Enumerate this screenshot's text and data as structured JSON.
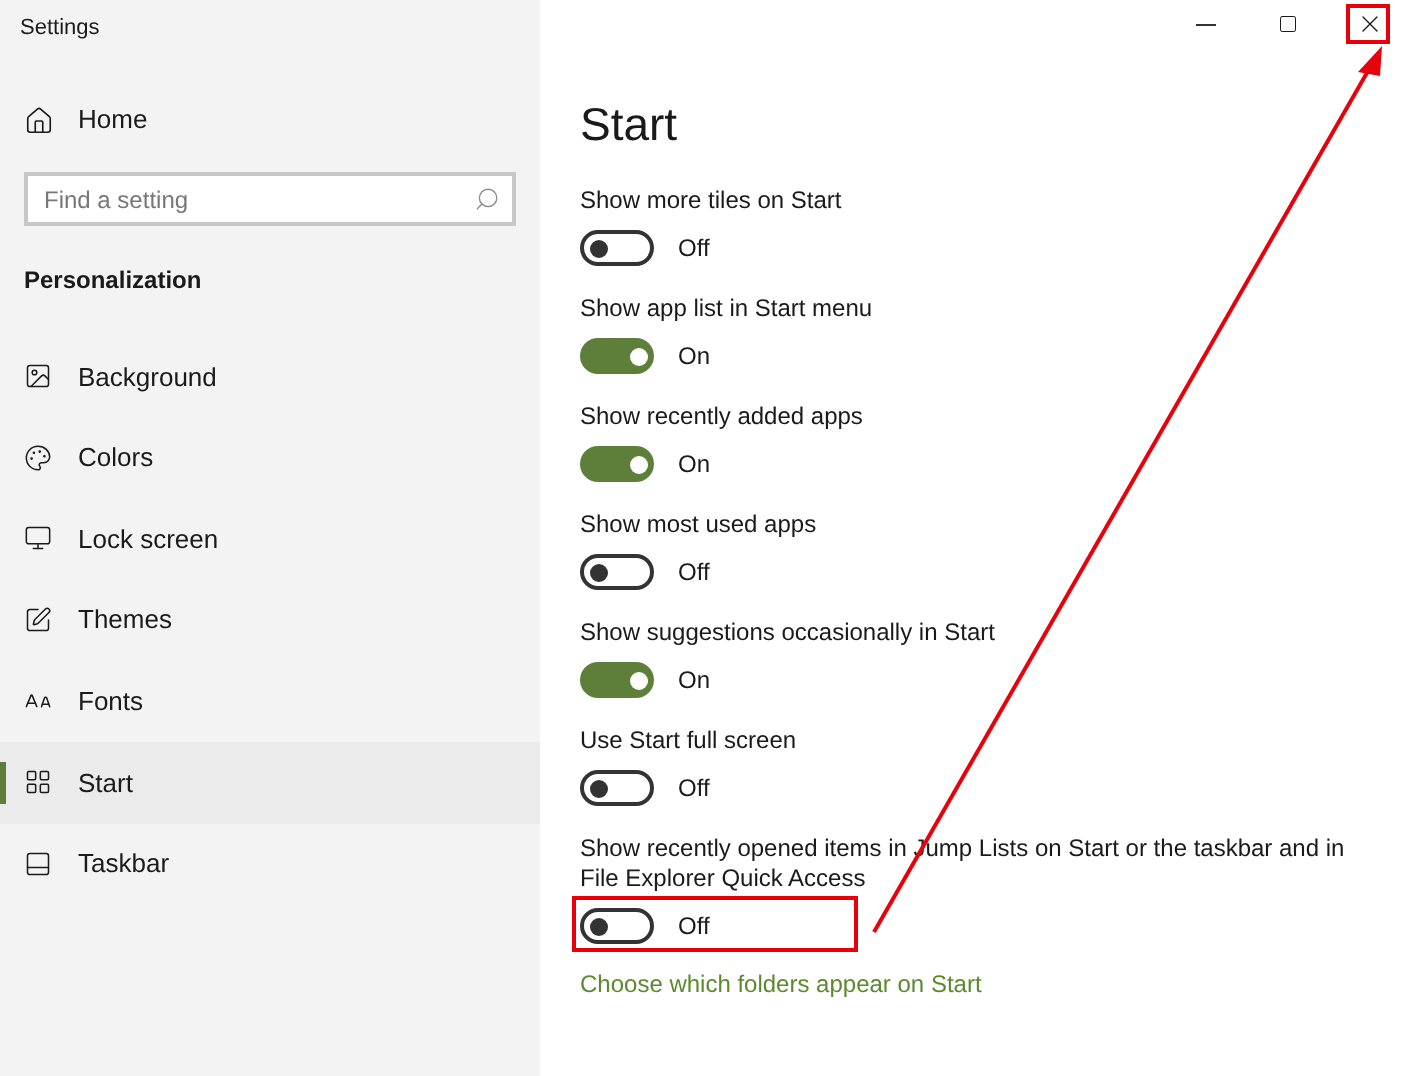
{
  "window": {
    "title": "Settings"
  },
  "sidebar": {
    "home": "Home",
    "search": {
      "placeholder": "Find a setting"
    },
    "section": "Personalization",
    "items": [
      {
        "label": "Background",
        "selected": false
      },
      {
        "label": "Colors",
        "selected": false
      },
      {
        "label": "Lock screen",
        "selected": false
      },
      {
        "label": "Themes",
        "selected": false
      },
      {
        "label": "Fonts",
        "selected": false
      },
      {
        "label": "Start",
        "selected": true
      },
      {
        "label": "Taskbar",
        "selected": false
      }
    ]
  },
  "page": {
    "title": "Start",
    "settings": [
      {
        "label": "Show more tiles on Start",
        "on": false,
        "status": "Off"
      },
      {
        "label": "Show app list in Start menu",
        "on": true,
        "status": "On"
      },
      {
        "label": "Show recently added apps",
        "on": true,
        "status": "On"
      },
      {
        "label": "Show most used apps",
        "on": false,
        "status": "Off"
      },
      {
        "label": "Show suggestions occasionally in Start",
        "on": true,
        "status": "On"
      },
      {
        "label": "Use Start full screen",
        "on": false,
        "status": "Off"
      },
      {
        "label": "Show recently opened items in Jump Lists on Start or the taskbar and in File Explorer Quick Access",
        "on": false,
        "status": "Off",
        "highlighted": true
      }
    ],
    "link": "Choose which folders appear on Start"
  },
  "annotations": {
    "close_highlighted": true,
    "arrow": true
  }
}
